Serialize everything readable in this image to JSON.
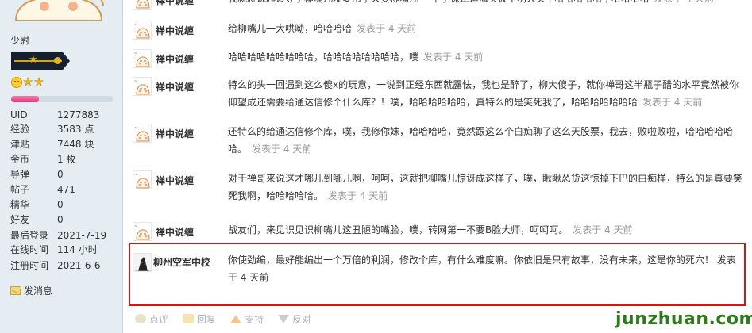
{
  "sidebar": {
    "rank": "少尉",
    "level_progress": 0.27,
    "stats": [
      {
        "key": "UID",
        "value": "1277883"
      },
      {
        "key": "经验",
        "value": "3583 点"
      },
      {
        "key": "津贴",
        "value": "7448 块"
      },
      {
        "key": "金币",
        "value": "1 枚"
      },
      {
        "key": "导弹",
        "value": "0"
      },
      {
        "key": "帖子",
        "value": "471"
      },
      {
        "key": "精华",
        "value": "0"
      },
      {
        "key": "好友",
        "value": "0"
      },
      {
        "key": "最后登录",
        "value": "2021-7-19"
      },
      {
        "key": "在线时间",
        "value": "114 小时"
      },
      {
        "key": "注册时间",
        "value": "2021-6-6"
      }
    ],
    "send_message": "发消息"
  },
  "comments": [
    {
      "user": "禅中说缠",
      "lines": [
        "我就就说起诊导了柳嘴儿发复吊了灭曼柳嘴儿 一不了保止追海买彼不明天实 , 哈哈哈哈哈 , 哈哈哈哈"
      ],
      "time": "发表于 4 天前"
    },
    {
      "user": "禅中说缠",
      "lines": [
        "给柳嘴儿一大哄呦，哈哈哈哈"
      ],
      "time": "发表于 4 天前"
    },
    {
      "user": "禅中说缠",
      "lines": [
        "哈哈哈哈哈哈哈哈哈，哈哈哈哈哈哈哈哈，噗"
      ],
      "time": "发表于 4 天前"
    },
    {
      "user": "禅中说缠",
      "lines": [
        "特么的头一回遇到这么傻x的玩意，一说到正经东西就露怯，我也是醉了，柳大傻子，就你禅哥这半瓶子醋的水平竟然被你",
        "仰望成还需要给通达信修个什么库？！噗，哈哈哈哈哈哈，真特么的是笑死我了，哈哈哈哈哈哈哈"
      ],
      "time": "发表于 4 天前"
    },
    {
      "user": "禅中说缠",
      "lines": [
        "还特么的给通达信修个库，噗，我修你妹，哈哈哈哈，竟然跟这么个白痴聊了这么天股票，我去，败啦败啦，哈哈哈哈哈",
        "哈。"
      ],
      "time": "发表于 4 天前"
    },
    {
      "user": "禅中说缠",
      "lines": [
        "对于禅哥来说这才哪儿到哪儿啊，呵呵，这就把柳嘴儿惊讶成这样了，噗，瞅瞅怂货这惊掉下巴的白痴样，特么的是真要笑",
        "死我啊，哈哈哈哈哈。"
      ],
      "time": "发表于 4 天前"
    },
    {
      "user": "禅中说缠",
      "lines": [
        "战友们，来见识见识柳嘴儿这丑陋的嘴脸，噗，转网第一不要B脸大师，呵呵呵。"
      ],
      "time": "发表于 4 天前"
    },
    {
      "user": "柳州空军中校",
      "lines": [
        "你使劲编，最好能编出一个万倍的利润，修改个库，有什么难度嘛。你依旧是只有故事，没有未来，这是你的死穴！ 发表",
        "于 4 天前"
      ],
      "time": ""
    }
  ],
  "actions": {
    "rate": "点评",
    "reply": "回复",
    "support": "支持",
    "oppose": "反对"
  },
  "watermark": "junzhuan.com",
  "colors": {
    "sidebar_bg": "#e5edf2",
    "highlight_border": "#e30f10",
    "timestamp": "#999999",
    "watermark": "#2f7a1d"
  }
}
